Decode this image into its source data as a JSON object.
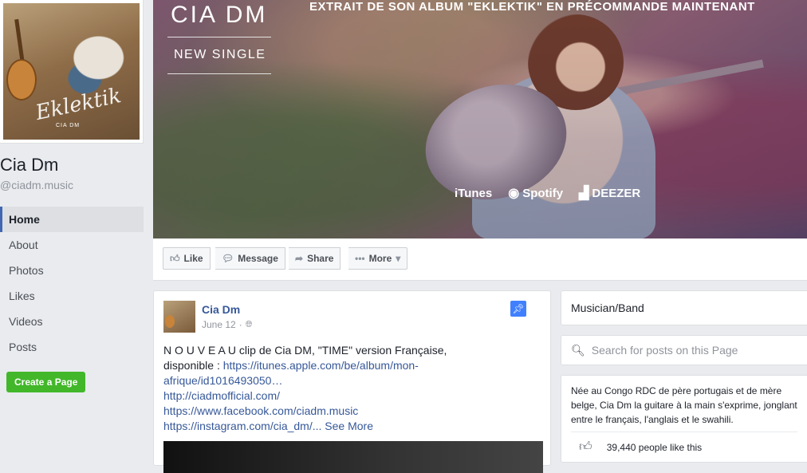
{
  "page": {
    "name": "Cia Dm",
    "handle": "@ciadm.music",
    "profile_art_script": "Eklektik",
    "profile_art_sub": "CIA DM"
  },
  "nav": {
    "items": [
      {
        "label": "Home",
        "active": true
      },
      {
        "label": "About"
      },
      {
        "label": "Photos"
      },
      {
        "label": "Likes"
      },
      {
        "label": "Videos"
      },
      {
        "label": "Posts"
      }
    ],
    "create_page": "Create a Page"
  },
  "cover": {
    "brand": "CIA DM",
    "single": "NEW SINGLE",
    "promo": "EXTRAIT DE SON ALBUM \"EKLEKTIK\" EN PRÉCOMMANDE MAINTENANT",
    "stores": [
      {
        "icon": "apple-icon",
        "label": "iTunes"
      },
      {
        "icon": "spotify-icon",
        "label": "Spotify"
      },
      {
        "icon": "deezer-icon",
        "label": "DEEZER"
      }
    ]
  },
  "actions": {
    "like": "Like",
    "message": "Message",
    "share": "Share",
    "more": "More"
  },
  "post": {
    "author": "Cia Dm",
    "date": "June 12",
    "text": "N O U V E A U clip de Cia DM, \"TIME\" version Française, disponible : ",
    "links": [
      "https://itunes.apple.com/be/album/mon-afrique/id1016493050…",
      "http://ciadmofficial.com/",
      "https://www.facebook.com/ciadm.music",
      "https://instagram.com/cia_dm/..."
    ],
    "see_more": "See More"
  },
  "sidebar": {
    "category": "Musician/Band",
    "search_placeholder": "Search for posts on this Page",
    "about_text": "Née au Congo RDC de père portugais et de mère belge, Cia Dm la guitare à la main s'exprime, jonglant entre le français, l'anglais et le swahili.",
    "likes_text": "39,440 people like this"
  },
  "colors": {
    "accent": "#4267b2",
    "link": "#365899",
    "create_button": "#42b72a",
    "pin": "#4080ff"
  }
}
